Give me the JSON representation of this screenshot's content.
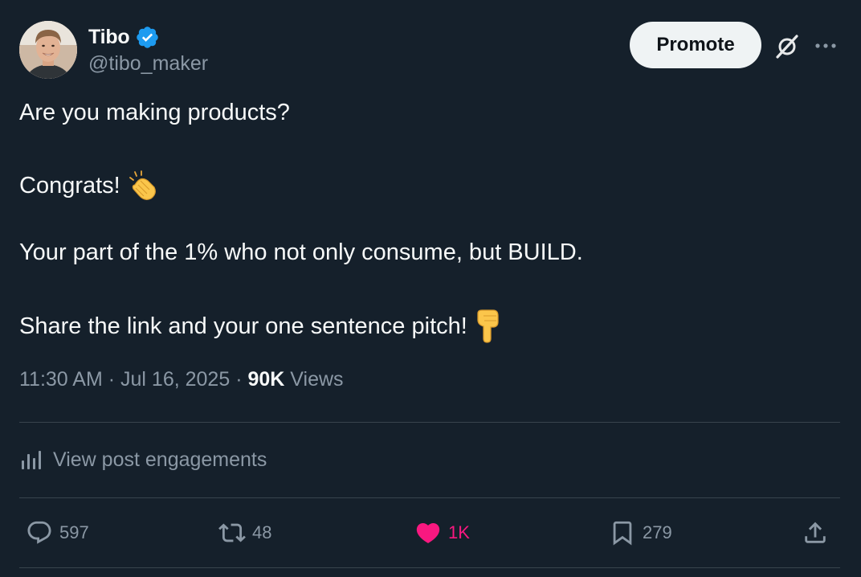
{
  "author": {
    "display_name": "Tibo",
    "handle": "@tibo_maker",
    "verified": true
  },
  "header": {
    "promote_label": "Promote"
  },
  "post": {
    "lines": [
      "Are you making products?",
      "Congrats!",
      "Your part of the 1% who not only consume, but BUILD.",
      "Share the link and your one sentence pitch!"
    ],
    "emojis": [
      "clapping-hands",
      "backhand-index-pointing-down"
    ]
  },
  "meta": {
    "time": "11:30 AM",
    "date": "Jul 16, 2025",
    "separator": "·",
    "views_count": "90K",
    "views_label": "Views"
  },
  "engagements": {
    "label": "View post engagements"
  },
  "actions": {
    "replies": "597",
    "reposts": "48",
    "likes": "1K",
    "bookmarks": "279"
  },
  "colors": {
    "background": "#15202b",
    "text": "#f7f9f9",
    "secondary_text": "#8b98a5",
    "divider": "#38444d",
    "verified": "#1d9bf0",
    "like": "#f91880",
    "promote_bg": "#eff3f4"
  }
}
